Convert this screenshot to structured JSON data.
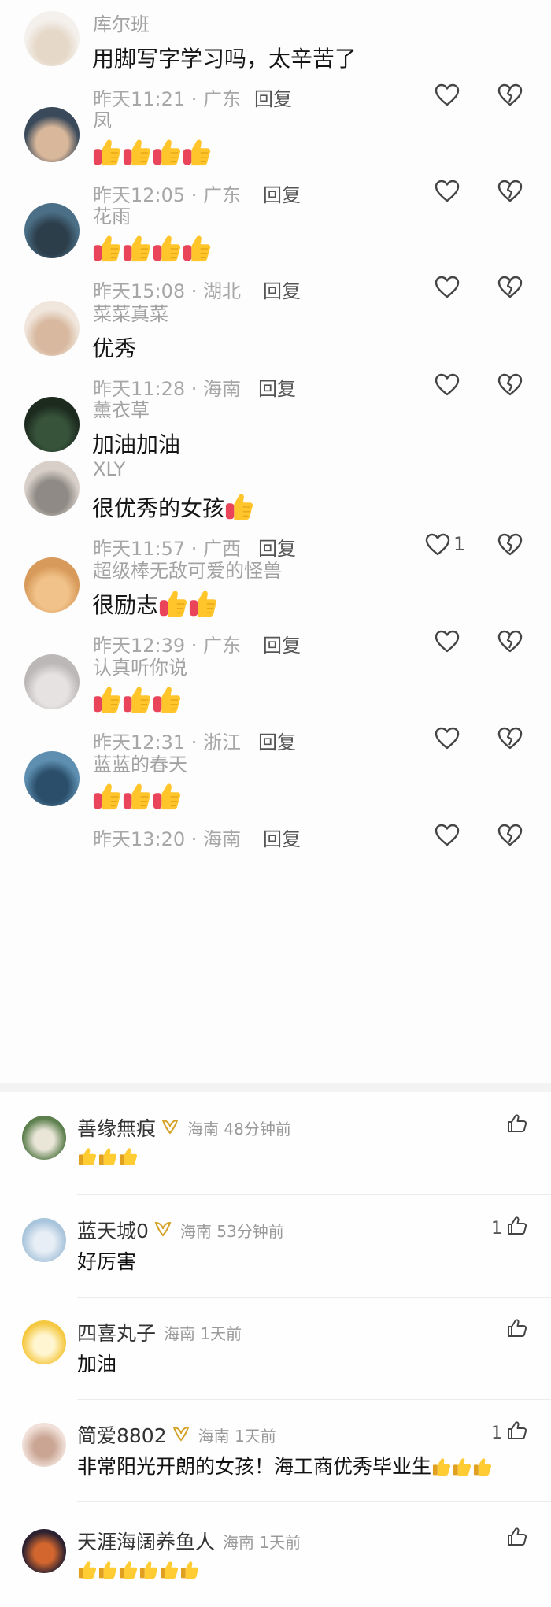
{
  "comments_top": [
    {
      "name": "库尔班",
      "text": "用脚写字学习吗，太辛苦了",
      "thumbs": 0,
      "meta": "昨天11:21 · 广东",
      "reply": "回复",
      "likes": ""
    },
    {
      "name": "凤",
      "text": "",
      "thumbs": 4,
      "meta": "昨天12:05 · 广东",
      "reply": "回复",
      "likes": ""
    },
    {
      "name": "花雨",
      "text": "",
      "thumbs": 4,
      "meta": "昨天15:08 · 湖北",
      "reply": "回复",
      "likes": ""
    },
    {
      "name": "菜菜真菜",
      "text": "优秀",
      "thumbs": 0,
      "meta": "昨天11:28 · 海南",
      "reply": "回复",
      "likes": ""
    },
    {
      "name": "薰衣草",
      "text": "加油加油",
      "thumbs": 0,
      "meta": "",
      "reply": "",
      "likes": ""
    },
    {
      "name": "XLY",
      "text": "很优秀的女孩",
      "thumbs": 1,
      "meta": "昨天11:57 · 广西",
      "reply": "回复",
      "likes": "1"
    },
    {
      "name": "超级棒无敌可爱的怪兽",
      "text": "很励志",
      "thumbs": 2,
      "meta": "昨天12:39 · 广东",
      "reply": "回复",
      "likes": ""
    },
    {
      "name": "认真听你说",
      "text": "",
      "thumbs": 3,
      "meta": "昨天12:31 · 浙江",
      "reply": "回复",
      "likes": ""
    },
    {
      "name": "蓝蓝的春天",
      "text": "",
      "thumbs": 3,
      "meta": "昨天13:20 · 海南",
      "reply": "回复",
      "likes": ""
    }
  ],
  "comments_bottom": [
    {
      "name": "善缘無痕",
      "badge": true,
      "loc": "海南 48分钟前",
      "text": "",
      "thumbs": 3,
      "likes": ""
    },
    {
      "name": "蓝天城0",
      "badge": true,
      "loc": "海南 53分钟前",
      "text": "好厉害",
      "thumbs": 0,
      "likes": "1"
    },
    {
      "name": "四喜丸子",
      "badge": false,
      "loc": "海南 1天前",
      "text": "加油",
      "thumbs": 0,
      "likes": ""
    },
    {
      "name": "简爱8802",
      "badge": true,
      "loc": "海南 1天前",
      "text": "非常阳光开朗的女孩！海工商优秀毕业生",
      "thumbs": 3,
      "likes": "1"
    },
    {
      "name": "天涯海阔养鱼人",
      "badge": false,
      "loc": "海南 1天前",
      "text": "",
      "thumbs": 6,
      "likes": ""
    }
  ]
}
